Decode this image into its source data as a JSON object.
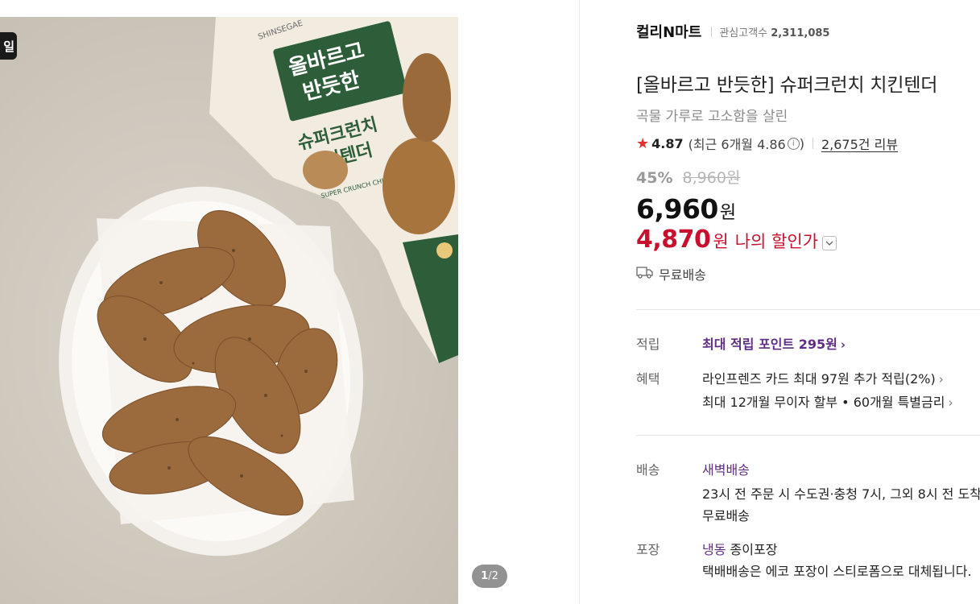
{
  "gallery": {
    "corner_badge": "일",
    "pager_current": "1",
    "pager_total": "2",
    "pager_sep": "/",
    "package_texts": {
      "brand_strip": "SHINSEGAE",
      "line1": "올바르고",
      "line2": "반듯한",
      "line3": "슈퍼크런치",
      "line4": "치킨텐더",
      "english": "SUPER CRUNCH CHICKEN TENDER"
    }
  },
  "product": {
    "brand": "컬리N마트",
    "interest_label": "관심고객수",
    "interest_count": "2,311,085",
    "title": "[올바르고 반듯한] 슈퍼크런치 치킨텐더",
    "subtitle": "곡물 가루로 고소함을 살린",
    "star_icon": "★",
    "rating": "4.87",
    "recent_rating": "(최근 6개월 4.86",
    "recent_close": ")",
    "info_icon": "i",
    "review_count": "2,675건 리뷰",
    "discount_rate": "45%",
    "original_price": "8,960원",
    "price": "6,960",
    "currency": "원",
    "my_price": "4,870",
    "my_currency": "원",
    "my_price_label": "나의 할인가",
    "shipping_fee": "무료배송"
  },
  "details": {
    "points_label": "적립",
    "points_value": "최대 적립 포인트 295원",
    "benefit_label": "혜택",
    "benefit_line1": "라인프렌즈 카드 최대 97원 추가 적립(2%)",
    "benefit_line2": "최대 12개월 무이자 할부 • 60개월 특별금리",
    "delivery_label": "배송",
    "delivery_type": "새벽배송",
    "delivery_desc": "23시 전 주문 시 수도권·충청 7시, 그외 8시 전 도착",
    "delivery_fee": "무료배송",
    "packaging_label": "포장",
    "packaging_type": "냉동",
    "packaging_material": "종이포장",
    "packaging_desc": "택배배송은 에코 포장이 스티로폼으로 대체됩니다."
  },
  "colors": {
    "accent_purple": "#5f2d84",
    "sale_red": "#c8102e",
    "star_red": "#e03131"
  }
}
